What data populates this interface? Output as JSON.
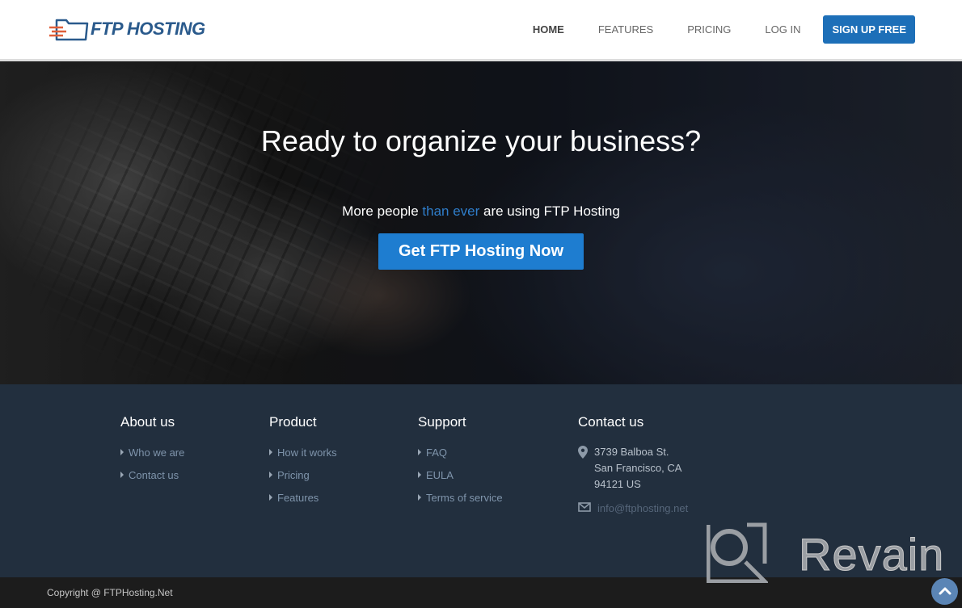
{
  "header": {
    "logo_text": "FTP HOSTING",
    "nav": [
      {
        "label": "HOME",
        "active": true
      },
      {
        "label": "FEATURES",
        "active": false
      },
      {
        "label": "PRICING",
        "active": false
      },
      {
        "label": "LOG IN",
        "active": false
      }
    ],
    "signup_label": "SIGN UP FREE"
  },
  "hero": {
    "title": "Ready to organize your business?",
    "subtitle_pre": "More people ",
    "subtitle_highlight": "than ever",
    "subtitle_post": " are using FTP Hosting",
    "cta_label": "Get FTP Hosting Now"
  },
  "footer": {
    "about": {
      "heading": "About us",
      "links": [
        "Who we are",
        "Contact us"
      ]
    },
    "product": {
      "heading": "Product",
      "links": [
        "How it works",
        "Pricing",
        "Features"
      ]
    },
    "support": {
      "heading": "Support",
      "links": [
        "FAQ",
        "EULA",
        "Terms of service"
      ]
    },
    "contact": {
      "heading": "Contact us",
      "address_line1": "3739 Balboa St.",
      "address_line2": "San Francisco, CA",
      "address_line3": "94121 US",
      "email": "info@ftphosting.net"
    }
  },
  "watermark": {
    "text": "Revain"
  },
  "bottom": {
    "copyright": "Copyright @ FTPHosting.Net"
  },
  "colors": {
    "brand_blue": "#1d6fb8",
    "cta_blue": "#1e7dd0",
    "highlight_blue": "#2f7ecb",
    "footer_bg": "#222f3e",
    "bottom_bg": "#1c1c1c"
  }
}
